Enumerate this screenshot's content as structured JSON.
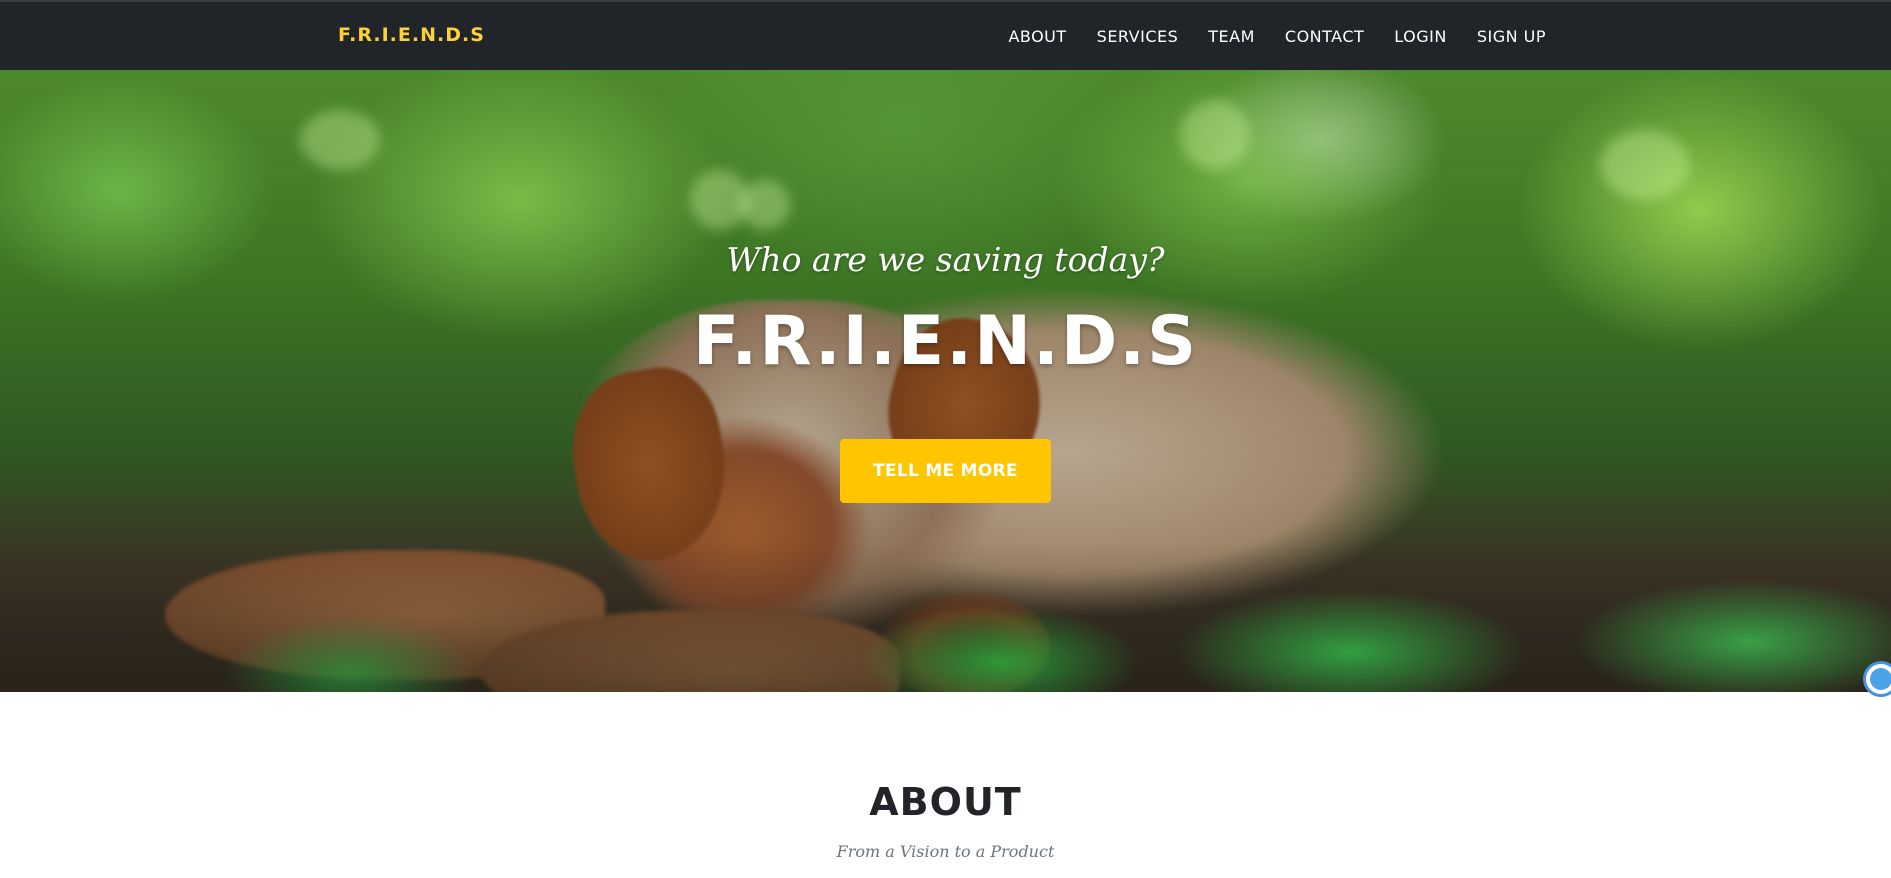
{
  "navbar": {
    "brand": "F.R.I.E.N.D.S",
    "links": [
      "ABOUT",
      "SERVICES",
      "TEAM",
      "CONTACT",
      "LOGIN",
      "SIGN UP"
    ]
  },
  "hero": {
    "lead": "Who are we saving today?",
    "heading": "F.R.I.E.N.D.S",
    "button_label": "TELL ME MORE"
  },
  "about": {
    "title": "ABOUT",
    "subtitle": "From a Vision to a Product"
  },
  "colors": {
    "navbar_bg": "#212529",
    "brand": "#fed136",
    "button": "#ffc600",
    "heading_dark": "#212529"
  },
  "icons": {
    "chat_widget": "chat-bubble-icon"
  }
}
